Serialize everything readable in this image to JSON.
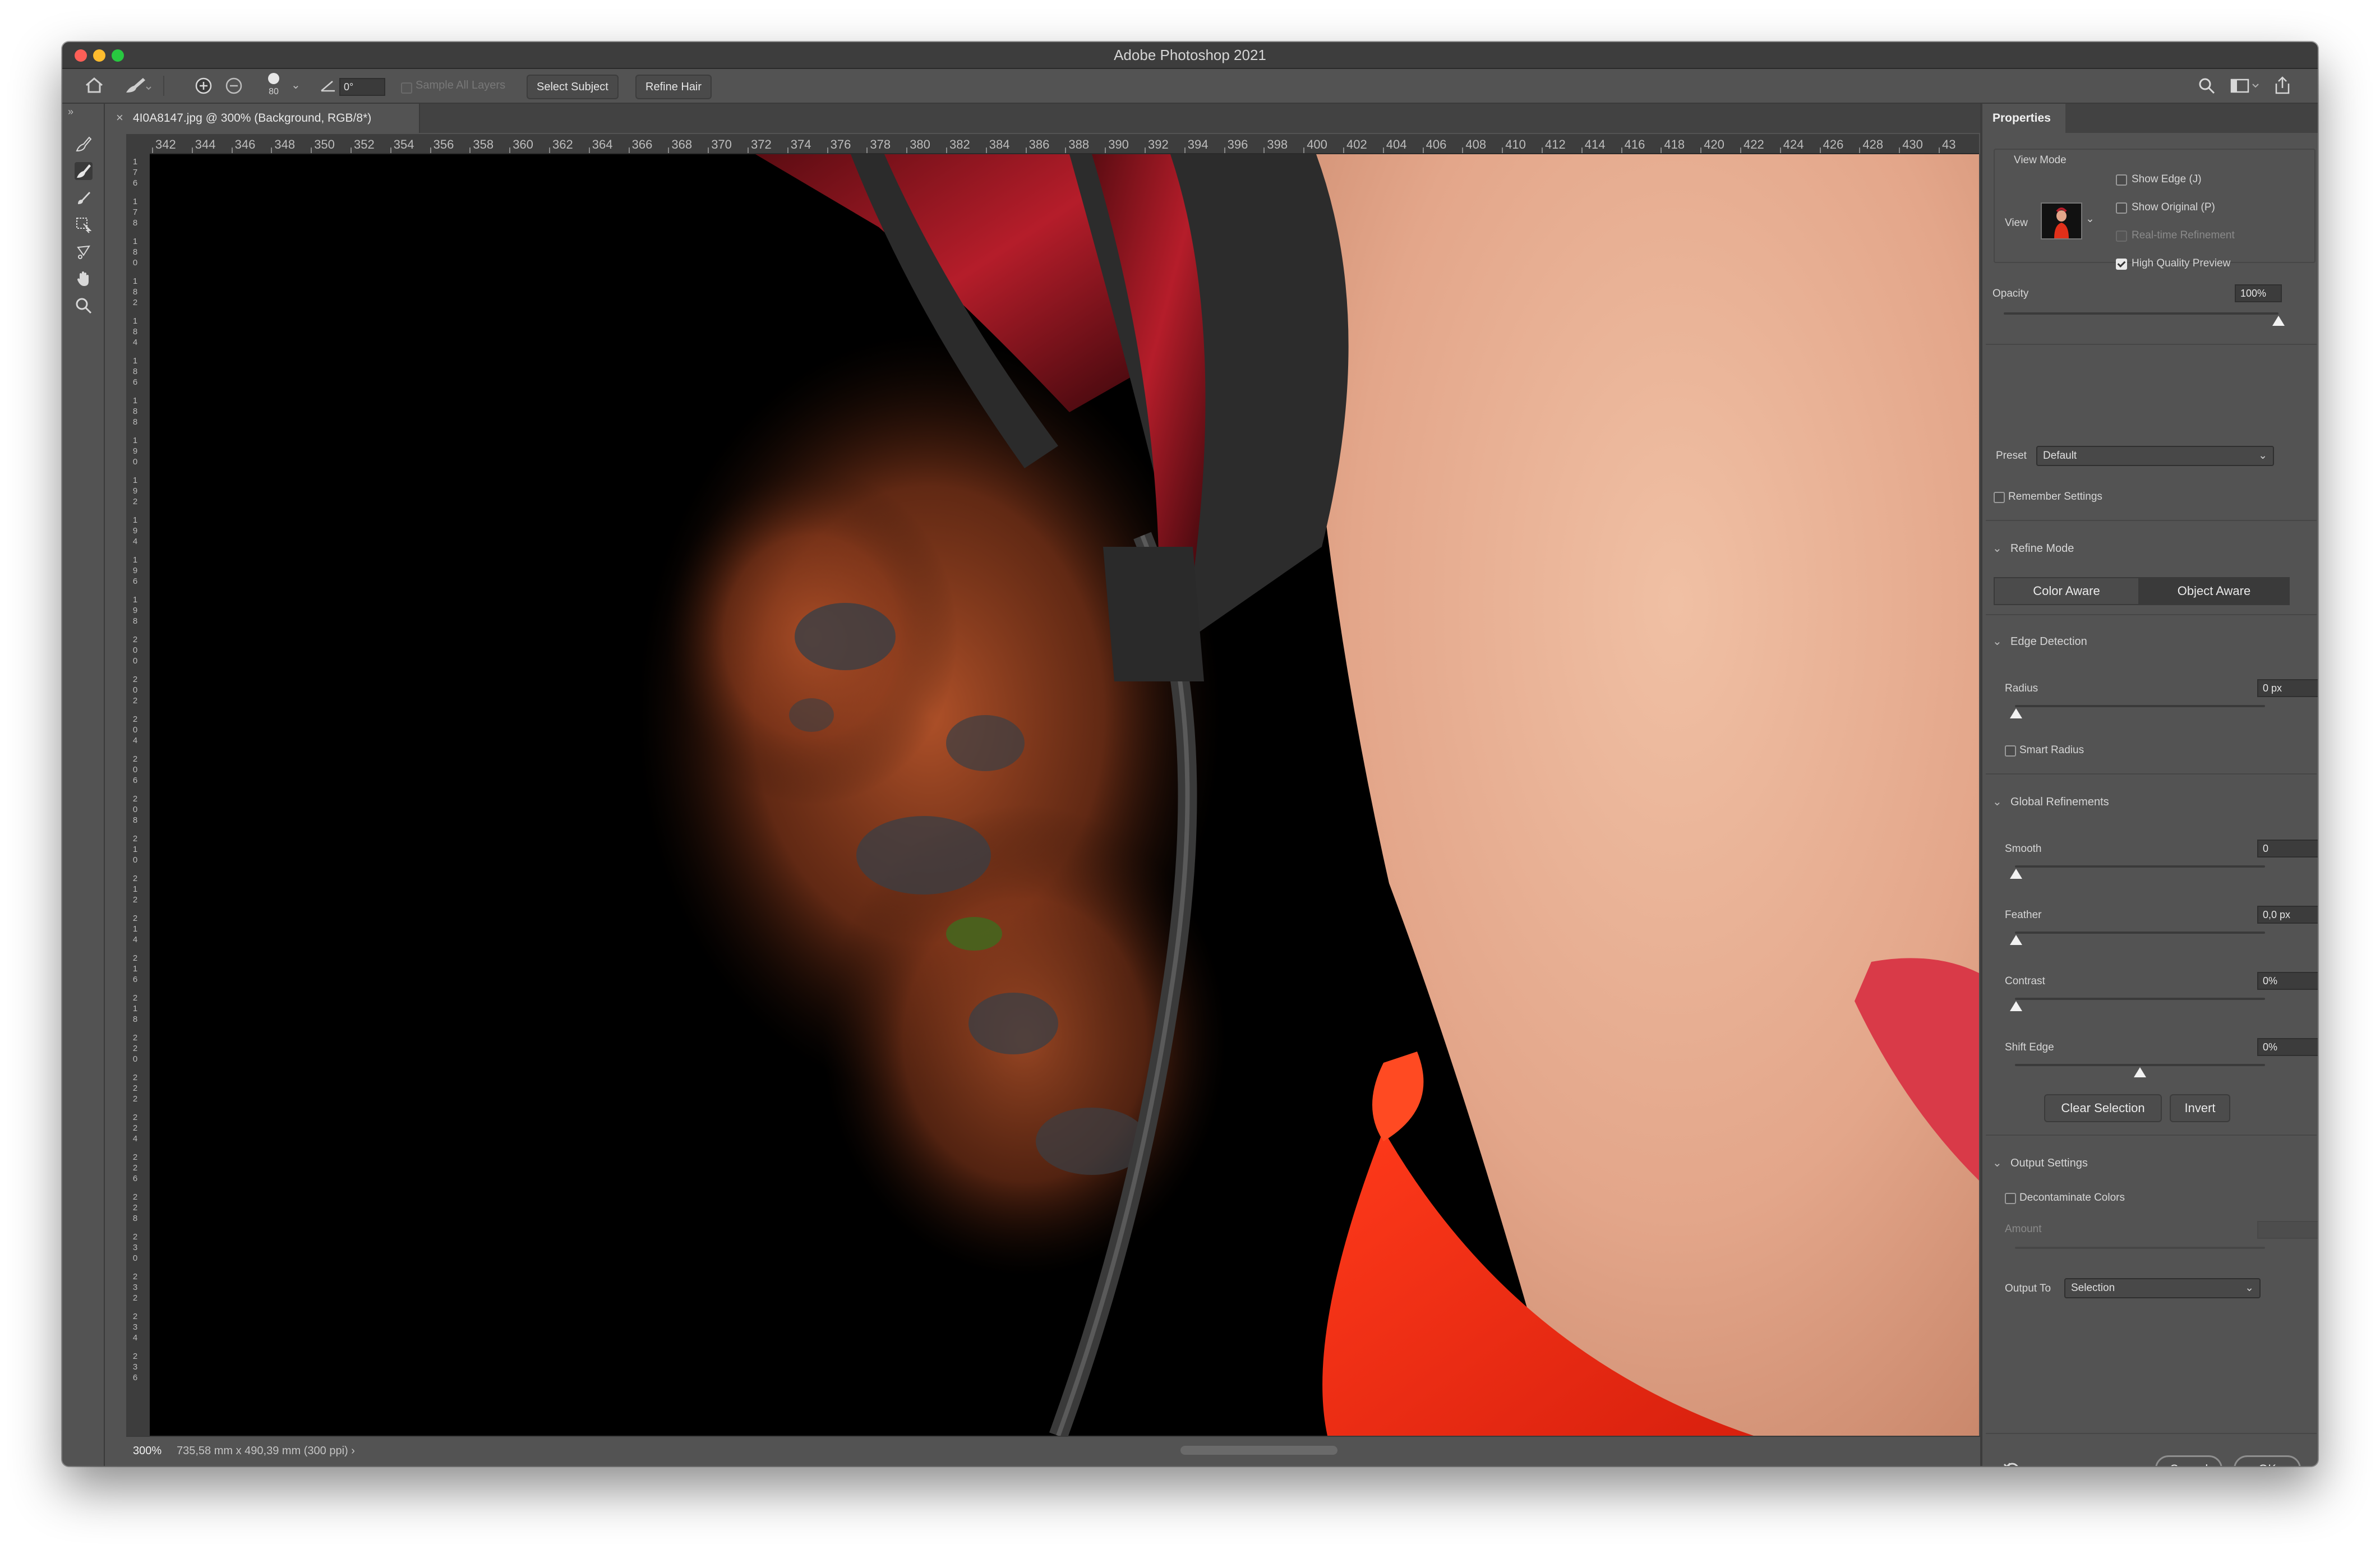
{
  "window": {
    "title": "Adobe Photoshop 2021"
  },
  "options_bar": {
    "brush_size": "80",
    "angle": "0°",
    "sample_all_layers": "Sample All Layers",
    "select_subject": "Select Subject",
    "refine_hair": "Refine Hair"
  },
  "document": {
    "tab_label": "4I0A8147.jpg @ 300% (Background, RGB/8*)",
    "zoom": "300%",
    "info": "735,58 mm x 490,39 mm (300 ppi)"
  },
  "ruler": {
    "horizontal": [
      "342",
      "344",
      "346",
      "348",
      "350",
      "352",
      "354",
      "356",
      "358",
      "360",
      "362",
      "364",
      "366",
      "368",
      "370",
      "372",
      "374",
      "376",
      "378",
      "380",
      "382",
      "384",
      "386",
      "388",
      "390",
      "392",
      "394",
      "396",
      "398",
      "400",
      "402",
      "404",
      "406",
      "408",
      "410",
      "412",
      "414",
      "416",
      "418",
      "420",
      "422",
      "424",
      "426",
      "428",
      "430",
      "43"
    ],
    "vertical": [
      "176",
      "178",
      "180",
      "182",
      "184",
      "186",
      "188",
      "190",
      "192",
      "194",
      "196",
      "198",
      "200",
      "202",
      "204",
      "206",
      "208",
      "210",
      "212",
      "214",
      "216",
      "218",
      "220",
      "222",
      "224",
      "226",
      "228",
      "230",
      "232",
      "234",
      "236"
    ]
  },
  "properties": {
    "tab": "Properties",
    "view_mode": {
      "heading": "View Mode",
      "view_label": "View",
      "show_edge": "Show Edge (J)",
      "show_original": "Show Original (P)",
      "realtime_refinement": "Real-time Refinement",
      "high_quality_preview": "High Quality Preview"
    },
    "opacity": {
      "label": "Opacity",
      "value": "100%",
      "level": 1.0
    },
    "preset": {
      "label": "Preset",
      "value": "Default"
    },
    "remember_settings": "Remember Settings",
    "refine_mode": {
      "heading": "Refine Mode",
      "color_aware": "Color Aware",
      "object_aware": "Object Aware"
    },
    "edge_detection": {
      "heading": "Edge Detection",
      "radius_label": "Radius",
      "radius_value": "0 px",
      "smart_radius": "Smart Radius"
    },
    "global_refinements": {
      "heading": "Global Refinements",
      "smooth_label": "Smooth",
      "smooth_value": "0",
      "feather_label": "Feather",
      "feather_value": "0,0 px",
      "contrast_label": "Contrast",
      "contrast_value": "0%",
      "shift_edge_label": "Shift Edge",
      "shift_edge_value": "0%",
      "clear_selection": "Clear Selection",
      "invert": "Invert"
    },
    "output_settings": {
      "heading": "Output Settings",
      "decontaminate": "Decontaminate Colors",
      "amount_label": "Amount",
      "output_to_label": "Output To",
      "output_to_value": "Selection"
    },
    "cancel": "Cancel",
    "ok": "OK"
  }
}
